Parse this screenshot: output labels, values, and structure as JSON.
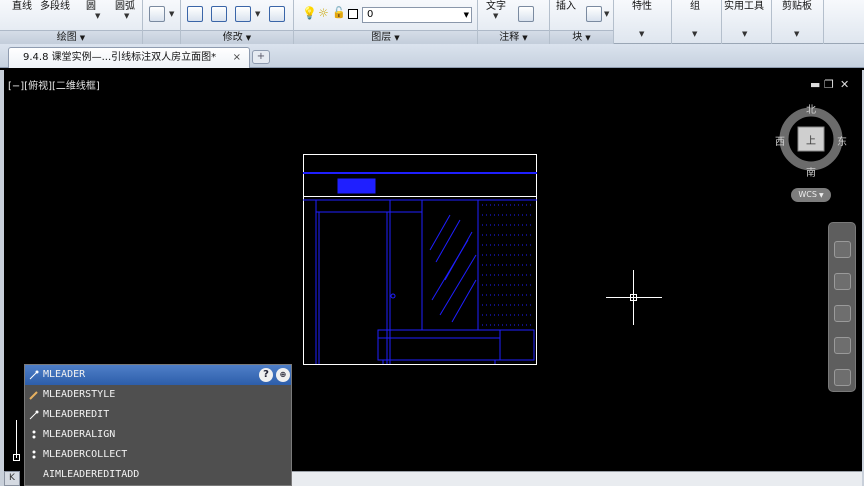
{
  "ribbon": {
    "draw_line": "直线",
    "draw_polyline": "多段线",
    "draw_circle": "圆",
    "draw_arc": "圆弧",
    "panels": {
      "draw": "绘图",
      "modify": "修改",
      "layers": "图层",
      "annotation": "注释",
      "block": "块",
      "properties": "特性",
      "groups": "组",
      "utilities": "实用工具",
      "clipboard": "剪贴板"
    },
    "layer_current": "0",
    "text_label": "文字",
    "insert_label": "插入"
  },
  "doc_tab": {
    "title": "9.4.8 课堂实例—...引线标注双人房立面图*",
    "close": "×",
    "new": "+"
  },
  "viewport": {
    "label": "[−][俯视][二维线框]",
    "minimize": "▬",
    "restore": "❐",
    "close": "✕"
  },
  "viewcube": {
    "north": "北",
    "south": "南",
    "east": "东",
    "west": "西",
    "face": "上",
    "wcs": "WCS"
  },
  "autocomplete": {
    "items": [
      {
        "label": "MLEADER",
        "selected": true
      },
      {
        "label": "MLEADERSTYLE",
        "selected": false
      },
      {
        "label": "MLEADEREDIT",
        "selected": false
      },
      {
        "label": "MLEADERALIGN",
        "selected": false
      },
      {
        "label": "MLEADERCOLLECT",
        "selected": false
      },
      {
        "label": "AIMLEADEREDITADD",
        "selected": false
      }
    ],
    "help": "?"
  },
  "colors": {
    "drawing_blue": "#1f1fff",
    "drawing_white": "#ffffff",
    "highlight": "#2d5eaa"
  }
}
